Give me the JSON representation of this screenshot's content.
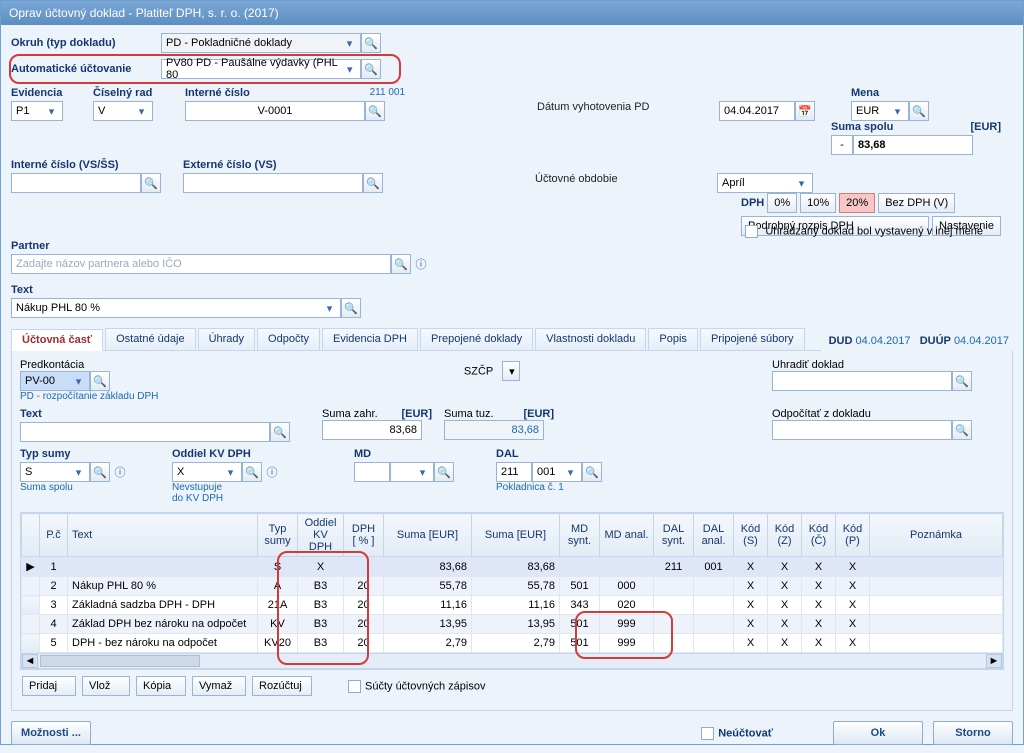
{
  "title": "Oprav účtovný doklad - Platiteľ DPH, s. r. o. (2017)",
  "okruh": {
    "label": "Okruh (typ dokladu)",
    "value": "PD - Pokladničné doklady"
  },
  "autouc": {
    "label": "Automatické účtovanie",
    "value": "PV80 PD - Paušálne výdavky (PHL 80"
  },
  "evidencia": {
    "label": "Evidencia",
    "value": "P1"
  },
  "ciselnyrad": {
    "label": "Číselný rad",
    "value": "V"
  },
  "internecislo": {
    "label": "Interné číslo",
    "value": "V-0001",
    "code": "211 001"
  },
  "internevs": {
    "label": "Interné číslo (VS/ŠS)",
    "value": ""
  },
  "externevs": {
    "label": "Externé číslo (VS)",
    "value": ""
  },
  "partner": {
    "label": "Partner",
    "placeholder": "Zadajte názov partnera alebo IČO"
  },
  "textfield": {
    "label": "Text",
    "value": "Nákup PHL 80 %"
  },
  "datumvyhot": {
    "label": "Dátum vyhotovenia PD",
    "value": "04.04.2017"
  },
  "uctobdobie": {
    "label": "Účtovné obdobie",
    "value": "Apríl"
  },
  "mena": {
    "label": "Mena",
    "value": "EUR"
  },
  "sumaspolu": {
    "label": "Suma spolu",
    "unit": "[EUR]",
    "sign": "-",
    "value": "83,68"
  },
  "dph": {
    "label": "DPH",
    "b0": "0%",
    "b10": "10%",
    "b20": "20%",
    "bez": "Bez DPH (V)",
    "rozpis": "Podrobný rozpis DPH",
    "nast": "Nastavenie"
  },
  "uhrcheck": "Uhrádzaný doklad bol vystavený v inej mene",
  "tabs": {
    "t1": "Účtovná časť",
    "t2": "Ostatné údaje",
    "t3": "Úhrady",
    "t4": "Odpočty",
    "t5": "Evidencia DPH",
    "t6": "Prepojené doklady",
    "t7": "Vlastnosti dokladu",
    "t8": "Popis",
    "t9": "Pripojené súbory"
  },
  "dates": {
    "dud_l": "DUD",
    "dud_v": "04.04.2017",
    "duup_l": "DUÚP",
    "duup_v": "04.04.2017"
  },
  "predkont": {
    "label": "Predkontácia",
    "value": "PV-00",
    "desc": "PD - rozpočítanie základu DPH"
  },
  "szcp": "SZČP",
  "uhradit": {
    "label": "Uhradiť doklad",
    "value": ""
  },
  "text2": {
    "label": "Text",
    "value": ""
  },
  "sumaz": {
    "label": "Suma zahr.",
    "unit": "[EUR]",
    "value": "83,68"
  },
  "sumat": {
    "label": "Suma tuz.",
    "unit": "[EUR]",
    "value": "83,68"
  },
  "odpocitat": {
    "label": "Odpočítať z dokladu",
    "value": ""
  },
  "typsumy": {
    "label": "Typ sumy",
    "value": "S",
    "desc": "Suma spolu"
  },
  "oddiel": {
    "label": "Oddiel KV DPH",
    "value": "X",
    "desc": "Nevstupuje\ndo KV DPH"
  },
  "md": {
    "label": "MD",
    "v1": "",
    "v2": ""
  },
  "dal": {
    "label": "DAL",
    "v1": "211",
    "v2": "001",
    "desc": "Pokladnica č. 1"
  },
  "thead": {
    "pc": "P.č",
    "text": "Text",
    "ts": "Typ\nsumy",
    "okd": "Oddiel\nKV DPH",
    "dphp": "DPH\n[ % ]",
    "s1": "Suma [EUR]",
    "s2": "Suma [EUR]",
    "mds": "MD\nsynt.",
    "mda": "MD anal.",
    "dals": "DAL\nsynt.",
    "dala": "DAL\nanal.",
    "ks": "Kód\n(S)",
    "kz": "Kód\n(Z)",
    "kc": "Kód\n(Č)",
    "kp": "Kód\n(P)",
    "poz": "Poznámka"
  },
  "rows": [
    {
      "pc": "1",
      "text": "",
      "ts": "S",
      "okd": "X",
      "dphp": "",
      "s1": "83,68",
      "s2": "83,68",
      "mds": "",
      "mda": "",
      "dals": "211",
      "dala": "001",
      "ks": "X",
      "kz": "X",
      "kc": "X",
      "kp": "X",
      "poz": ""
    },
    {
      "pc": "2",
      "text": "Nákup PHL 80 %",
      "ts": "A",
      "okd": "B3",
      "dphp": "20",
      "s1": "55,78",
      "s2": "55,78",
      "mds": "501",
      "mda": "000",
      "dals": "",
      "dala": "",
      "ks": "X",
      "kz": "X",
      "kc": "X",
      "kp": "X",
      "poz": ""
    },
    {
      "pc": "3",
      "text": "Základná sadzba DPH - DPH",
      "ts": "21A",
      "okd": "B3",
      "dphp": "20",
      "s1": "11,16",
      "s2": "11,16",
      "mds": "343",
      "mda": "020",
      "dals": "",
      "dala": "",
      "ks": "X",
      "kz": "X",
      "kc": "X",
      "kp": "X",
      "poz": ""
    },
    {
      "pc": "4",
      "text": "Základ DPH bez nároku na odpočet",
      "ts": "KV",
      "okd": "B3",
      "dphp": "20",
      "s1": "13,95",
      "s2": "13,95",
      "mds": "501",
      "mda": "999",
      "dals": "",
      "dala": "",
      "ks": "X",
      "kz": "X",
      "kc": "X",
      "kp": "X",
      "poz": ""
    },
    {
      "pc": "5",
      "text": "DPH - bez nároku na odpočet",
      "ts": "KV20",
      "okd": "B3",
      "dphp": "20",
      "s1": "2,79",
      "s2": "2,79",
      "mds": "501",
      "mda": "999",
      "dals": "",
      "dala": "",
      "ks": "X",
      "kz": "X",
      "kc": "X",
      "kp": "X",
      "poz": ""
    }
  ],
  "rowbtns": {
    "pridaj": "Pridaj",
    "vloz": "Vlož",
    "kopia": "Kópia",
    "vymaz": "Vymaž",
    "rozuc": "Rozúčtuj",
    "sucty": "Súčty účtovných zápisov"
  },
  "footer": {
    "moznosti": "Možnosti ...",
    "neuc": "Neúčtovať",
    "ok": "Ok",
    "storno": "Storno"
  }
}
